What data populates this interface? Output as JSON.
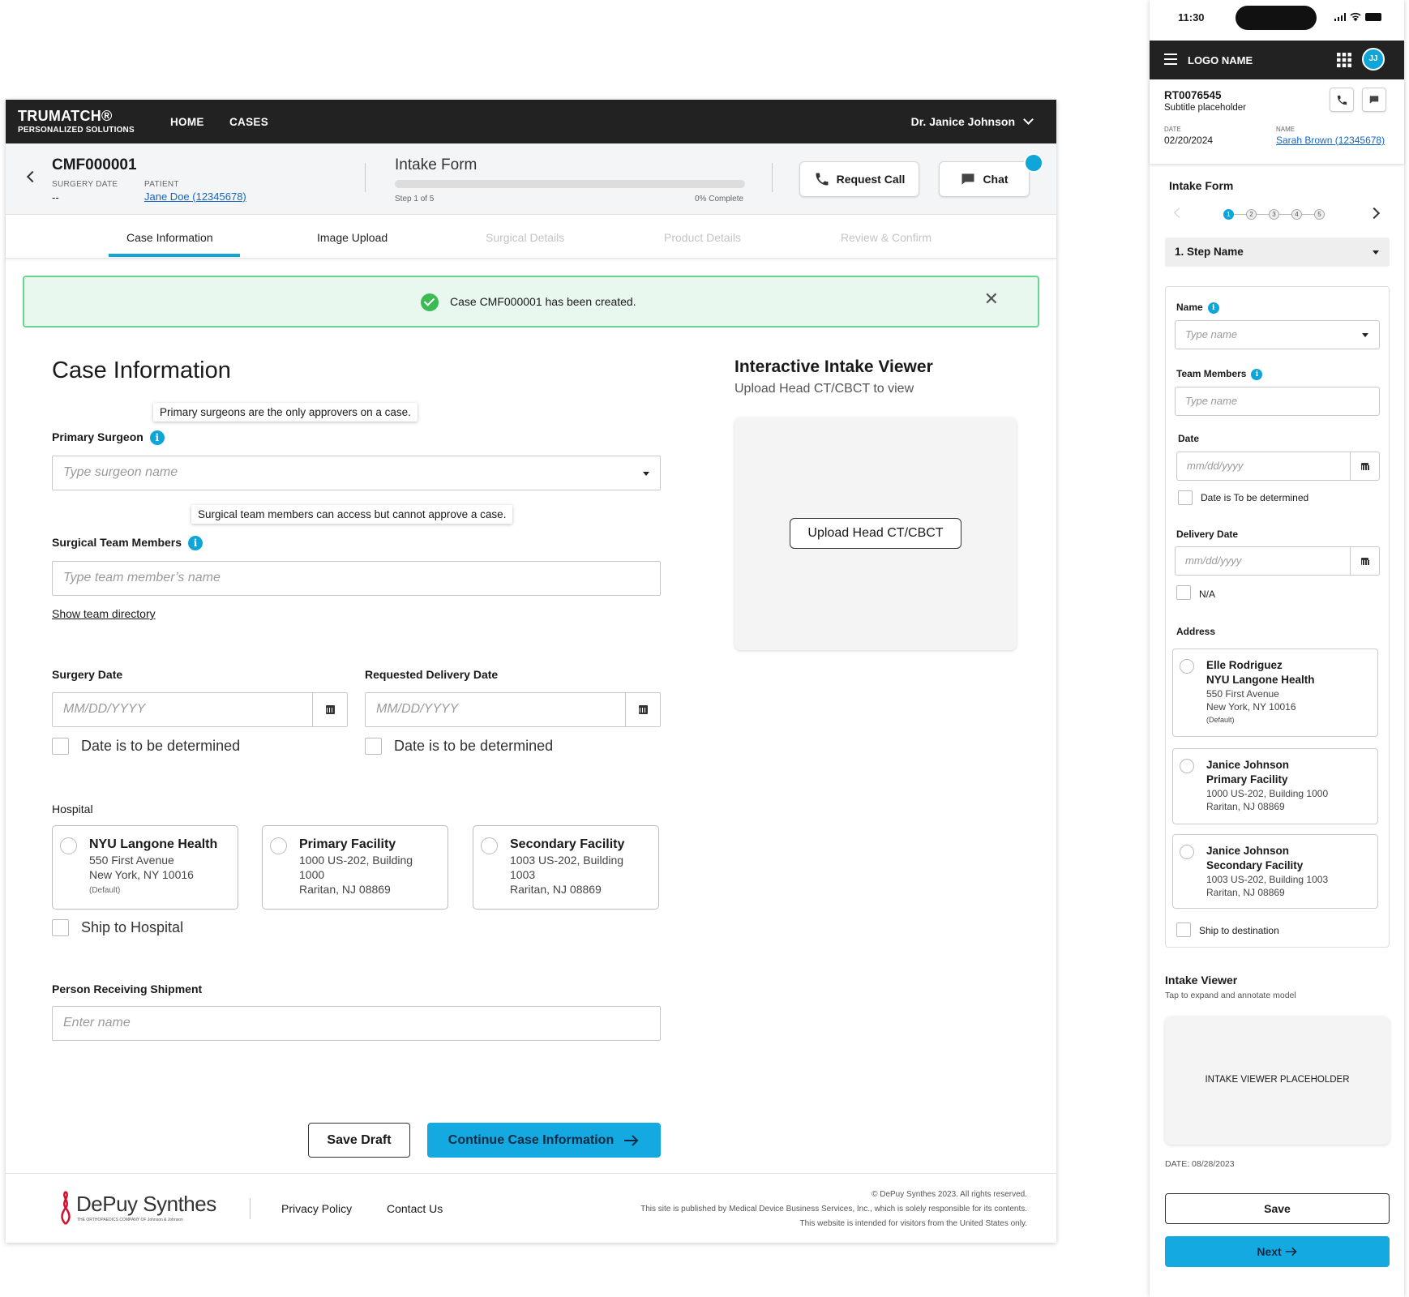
{
  "header": {
    "brand": "TRUMATCH®",
    "brand_sub": "PERSONALIZED SOLUTIONS",
    "nav": [
      "HOME",
      "CASES"
    ],
    "user": "Dr. Janice Johnson"
  },
  "case": {
    "id": "CMF000001",
    "surgery_date_label": "SURGERY DATE",
    "surgery_date": "--",
    "patient_label": "PATIENT",
    "patient": "Jane Doe (12345678)",
    "intake_title": "Intake Form",
    "step_text": "Step 1 of 5",
    "complete_text": "0% Complete",
    "progress": 0,
    "request_call": "Request Call",
    "chat": "Chat"
  },
  "tabs": [
    "Case Information",
    "Image Upload",
    "Surgical Details",
    "Product Details",
    "Review & Confirm"
  ],
  "alert": {
    "message": "Case CMF000001 has been created."
  },
  "form": {
    "title": "Case Information",
    "primary_tooltip": "Primary surgeons are the only approvers on a case.",
    "primary_label": "Primary Surgeon",
    "primary_placeholder": "Type surgeon name",
    "team_tooltip": "Surgical team members can access but cannot approve a case.",
    "team_label": "Surgical Team Members",
    "team_placeholder": "Type team member’s name",
    "team_directory": "Show team directory",
    "surgery_date_label": "Surgery Date",
    "delivery_date_label": "Requested Delivery Date",
    "date_placeholder": "MM/DD/YYYY",
    "tbd": "Date is to be determined",
    "hospital_label": "Hospital",
    "hospitals": [
      {
        "name": "NYU Langone Health",
        "l1": "550 First Avenue",
        "l2": "New York, NY 10016",
        "l3": "(Default)"
      },
      {
        "name": "Primary Facility",
        "l1": "1000 US-202, Building",
        "l2": "1000",
        "l3": "Raritan, NJ 08869"
      },
      {
        "name": "Secondary Facility",
        "l1": "1003 US-202, Building",
        "l2": "1003",
        "l3": "Raritan, NJ 08869"
      }
    ],
    "ship_to_hospital": "Ship to Hospital",
    "receiver_label": "Person Receiving Shipment",
    "receiver_placeholder": "Enter name",
    "save_draft": "Save Draft",
    "continue": "Continue Case Information"
  },
  "viewer": {
    "title": "Interactive Intake Viewer",
    "subtitle": "Upload Head CT/CBCT to view",
    "button": "Upload Head CT/CBCT"
  },
  "footer": {
    "logo": "DePuy Synthes",
    "logo_sub": "THE ORTHOPAEDICS COMPANY OF Johnson & Johnson",
    "links": [
      "Privacy Policy",
      "Contact Us"
    ],
    "legal1": "© DePuy Synthes 2023. All rights reserved.",
    "legal2": "This site is published by Medical Device Business Services, Inc., which is solely responsible for its contents.",
    "legal3": "This website is intended for visitors from the United States only."
  },
  "mobile": {
    "time": "11:30",
    "logo": "LOGO NAME",
    "avatar": "JJ",
    "record": "RT0076545",
    "subtitle": "Subtitle placeholder",
    "date_label": "DATE",
    "date": "02/20/2024",
    "name_label": "NAME",
    "name": "Sarah Brown (12345678)",
    "intake_title": "Intake Form",
    "steps": [
      "1",
      "2",
      "3",
      "4",
      "5"
    ],
    "step_select": "1. Step Name",
    "name_field": "Name",
    "name_placeholder": "Type name",
    "team_field": "Team Members",
    "team_placeholder": "Type name",
    "date_field": "Date",
    "date_placeholder": "mm/dd/yyyy",
    "date_tbd": "Date is To be determined",
    "delivery_field": "Delivery Date",
    "na": "N/A",
    "address_label": "Address",
    "addresses": [
      {
        "n1": "Elle Rodriguez",
        "n2": "NYU Langone Health",
        "l1": "550 First Avenue",
        "l2": "New York, NY 10016",
        "l3": "(Default)"
      },
      {
        "n1": "Janice Johnson",
        "n2": "Primary Facility",
        "l1": "1000 US-202, Building 1000",
        "l2": "Raritan, NJ 08869"
      },
      {
        "n1": "Janice Johnson",
        "n2": "Secondary Facility",
        "l1": "1003 US-202, Building 1003",
        "l2": "Raritan, NJ 08869"
      }
    ],
    "ship_dest": "Ship to destination",
    "viewer_title": "Intake Viewer",
    "viewer_sub": "Tap to expand and annotate model",
    "viewer_placeholder": "INTAKE VIEWER PLACEHOLDER",
    "viewer_date": "DATE: 08/28/2023",
    "save": "Save",
    "next": "Next"
  },
  "colors": {
    "accent": "#14a9e0",
    "nav_bg": "#222222",
    "success_bg": "#e8f8ef",
    "success_border": "#66d68f"
  }
}
